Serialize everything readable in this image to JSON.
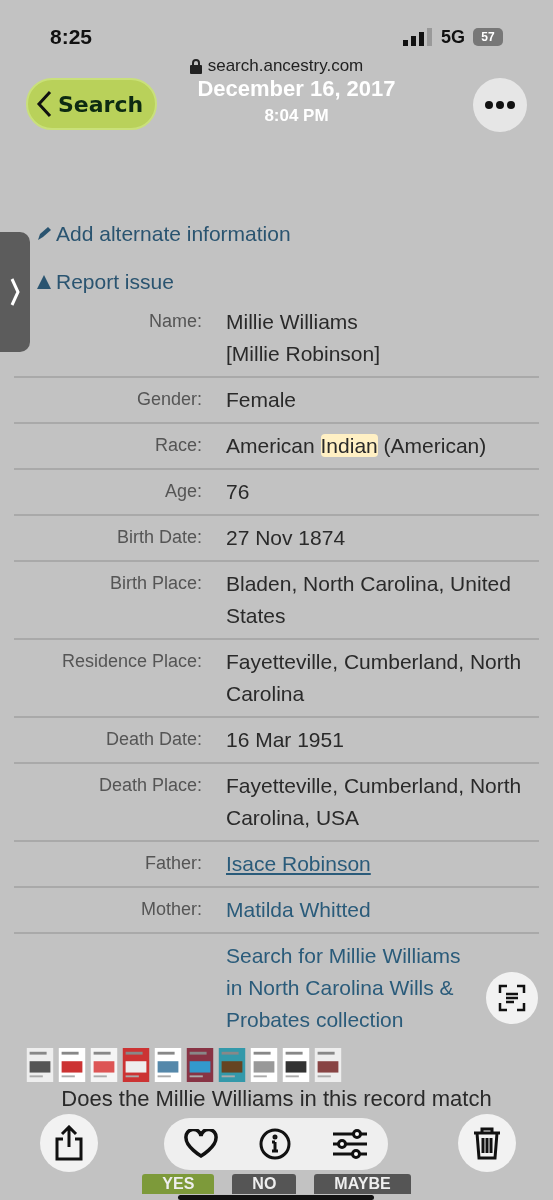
{
  "status_bar": {
    "time": "8:25",
    "network": "5G",
    "battery": "57"
  },
  "address_bar": {
    "url": "search.ancestry.com"
  },
  "photo_header": {
    "back_label": "Search",
    "date": "December 16, 2017",
    "time": "8:04 PM"
  },
  "actions": [
    {
      "label": "Add alternate information",
      "kind": "pencil"
    },
    {
      "label": "Report issue",
      "kind": "flag"
    }
  ],
  "record": [
    {
      "label": "Name:",
      "value": [
        {
          "text": "Millie Williams",
          "highlighted": false
        }
      ],
      "second_line": "[Millie Robinson]",
      "link": false
    },
    {
      "label": "Gender:",
      "value": [
        {
          "text": "Female",
          "highlighted": false
        }
      ],
      "link": false
    },
    {
      "label": "Race:",
      "value": [
        {
          "text": "American ",
          "highlighted": false
        },
        {
          "text": "Indian",
          "highlighted": true
        },
        {
          "text": " (American)",
          "highlighted": false
        }
      ],
      "link": false
    },
    {
      "label": "Age:",
      "value": [
        {
          "text": "76",
          "highlighted": false
        }
      ],
      "link": false
    },
    {
      "label": "Birth Date:",
      "value": [
        {
          "text": "27 Nov 1874",
          "highlighted": false
        }
      ],
      "link": false
    },
    {
      "label": "Birth Place:",
      "value": [
        {
          "text": "Bladen, North Carolina, United States",
          "highlighted": false
        }
      ],
      "link": false
    },
    {
      "label": "Residence Place:",
      "value": [
        {
          "text": "Fayetteville, Cumberland, North Carolina",
          "highlighted": false
        }
      ],
      "link": false
    },
    {
      "label": "Death Date:",
      "value": [
        {
          "text": "16 Mar 1951",
          "highlighted": false
        }
      ],
      "link": false
    },
    {
      "label": "Death Place:",
      "value": [
        {
          "text": "Fayetteville, Cumberland, North Carolina, USA",
          "highlighted": false
        }
      ],
      "link": false
    },
    {
      "label": "Father:",
      "value": [
        {
          "text": "Isace Robinson",
          "highlighted": false
        }
      ],
      "link": true,
      "underlined": true
    },
    {
      "label": "Mother:",
      "value": [
        {
          "text": "Matilda Whitted",
          "highlighted": false
        }
      ],
      "link": true,
      "underlined": false
    },
    {
      "value": [
        {
          "text": "Search for Millie Williams in North Carolina Wills & Probates collection",
          "highlighted": false
        }
      ],
      "link": true,
      "underlined": false
    }
  ],
  "question": "Does the Millie Williams in this record match",
  "answers": [
    {
      "label": "YES",
      "selected": true
    },
    {
      "label": "NO",
      "selected": false
    },
    {
      "label": "MAYBE",
      "selected": false
    }
  ]
}
